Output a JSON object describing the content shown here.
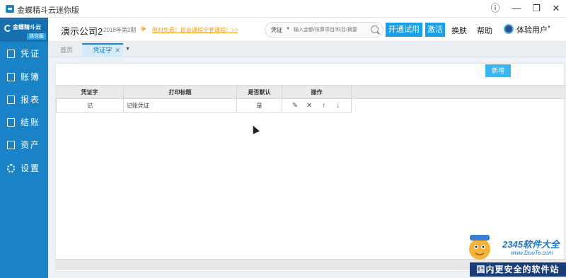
{
  "window": {
    "title": "金蝶精斗云迷你版"
  },
  "sidebar": {
    "logo_text": "金蝶精斗云",
    "logo_badge": "迷你版",
    "items": [
      {
        "label": "凭证",
        "icon": "edit-icon"
      },
      {
        "label": "账簿",
        "icon": "book-icon"
      },
      {
        "label": "报表",
        "icon": "report-icon"
      },
      {
        "label": "结账",
        "icon": "checkout-icon"
      },
      {
        "label": "资产",
        "icon": "asset-icon"
      },
      {
        "label": "设置",
        "icon": "gear-icon"
      }
    ]
  },
  "header": {
    "company": "演示公司2",
    "period": "2018年第2期",
    "promo": "限时免费！抢会课程全套课程！>>",
    "search_scope": "凭证",
    "search_placeholder": "输入金额/核算项目/科目/摘要",
    "trial_button": "开通试用",
    "activate_button": "激活",
    "skin_link": "换肤",
    "help_link": "帮助",
    "user_name": "体验用户"
  },
  "tabs": [
    {
      "label": "首页"
    },
    {
      "label": "凭证字"
    }
  ],
  "toolbar": {
    "new_button": "新增"
  },
  "table": {
    "headers": [
      "凭证字",
      "打印标题",
      "是否默认",
      "操作"
    ],
    "rows": [
      {
        "word": "记",
        "print_title": "记账凭证",
        "is_default": "是"
      }
    ],
    "op_icons": [
      "edit-icon",
      "delete-icon",
      "move-up-icon",
      "move-down-icon"
    ]
  },
  "watermark": {
    "logo": "2345软件大全",
    "url": "www.DuoTe.com",
    "slogan": "国内更安全的软件站"
  },
  "colors": {
    "sidebar": "#1a83c8",
    "accent": "#1aa0e8",
    "promo": "#f0a11e"
  }
}
